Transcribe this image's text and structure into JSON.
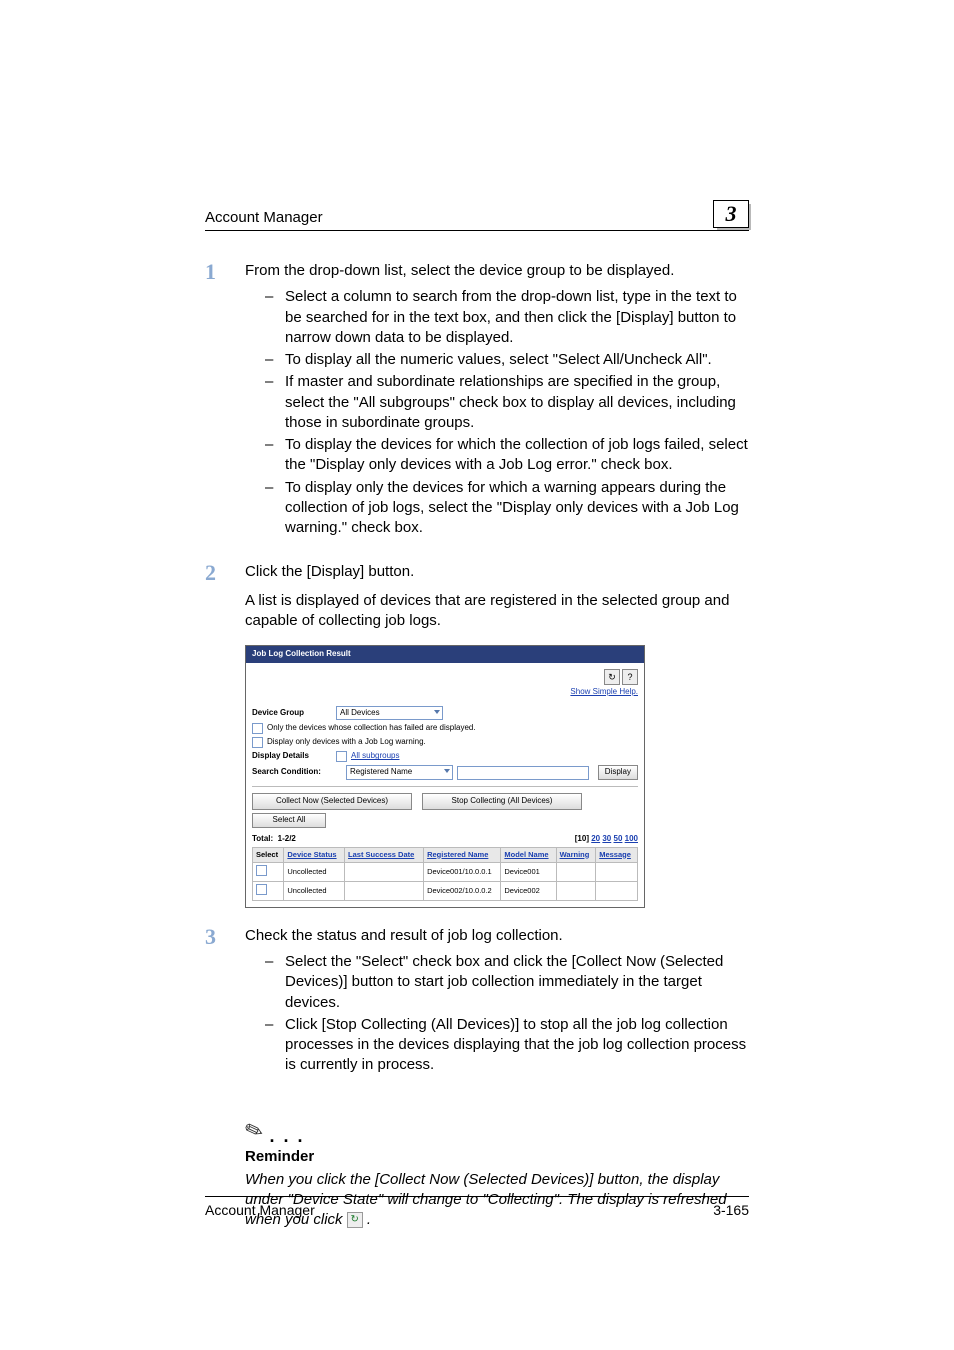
{
  "header": {
    "title": "Account Manager",
    "chapter": "3"
  },
  "steps": [
    {
      "num": "1",
      "text": "From the drop-down list, select the device group to be displayed.",
      "sub": [
        "Select a column to search from the drop-down list, type in the text to be searched for in the text box, and then click the [Display] button to narrow down data to be displayed.",
        "To display all the numeric values, select \"Select All/Uncheck All\".",
        "If master and subordinate relationships are specified in the group, select the \"All subgroups\" check box to display all devices, including those in subordinate groups.",
        "To display the devices for which the collection of job logs failed, select the \"Display only devices with a Job Log error.\" check box.",
        "To display only the devices for which a warning appears during the collection of job logs, select the \"Display only devices with a Job Log warning.\" check box."
      ]
    },
    {
      "num": "2",
      "text": "Click the [Display] button.",
      "para": "A list is displayed of devices that are registered in the selected group and capable of collecting job logs."
    },
    {
      "num": "3",
      "text": "Check the status and result of job log collection.",
      "sub": [
        "Select the \"Select\" check box and click the [Collect Now (Selected Devices)] button to start job collection immediately in the target devices.",
        "Click [Stop Collecting (All Devices)] to stop all the job log collection processes in the devices displaying that the job log collection process is currently in process."
      ]
    }
  ],
  "screenshot": {
    "title": "Job Log Collection Result",
    "help_link": "Show Simple Help.",
    "dev_group_lbl": "Device Group",
    "dev_group_val": "All Devices",
    "chk1": "Only the devices whose collection has failed are displayed.",
    "chk2": "Display only devices with a Job Log warning.",
    "disp_details_lbl": "Display Details",
    "all_subgroups": "All subgroups",
    "search_cond_lbl": "Search Condition:",
    "search_cond_val": "Registered Name",
    "display_btn": "Display",
    "collect_btn": "Collect Now (Selected Devices)",
    "stop_btn": "Stop Collecting (All Devices)",
    "select_all_btn": "Select All",
    "total_lbl": "Total:",
    "total_val": "1-2/2",
    "page_sizes": {
      "current": "[10]",
      "opts": [
        "20",
        "30",
        "50",
        "100"
      ]
    },
    "cols": [
      "Select",
      "Device Status",
      "Last Success Date",
      "Registered Name",
      "Model Name",
      "Warning",
      "Message"
    ],
    "rows": [
      {
        "status": "Uncollected",
        "last": "",
        "reg": "Device001/10.0.0.1",
        "model": "Device001",
        "warn": "",
        "msg": ""
      },
      {
        "status": "Uncollected",
        "last": "",
        "reg": "Device002/10.0.0.2",
        "model": "Device002",
        "warn": "",
        "msg": ""
      }
    ]
  },
  "reminder": {
    "heading": "Reminder",
    "body_before": "When you click the [Collect Now (Selected Devices)] button, the display under \"Device State\" will change to \"Collecting\". The display is refreshed when you click ",
    "body_after": " ."
  },
  "footer": {
    "left": "Account Manager",
    "right": "3-165"
  }
}
